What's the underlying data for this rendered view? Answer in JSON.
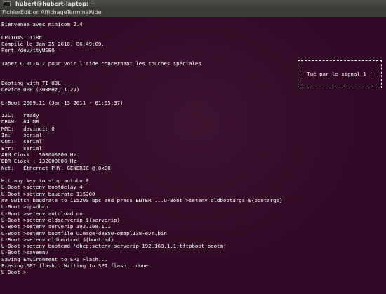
{
  "window": {
    "title": "hubert@hubert-laptop: ~"
  },
  "menu": [
    "Fichier",
    "Édition",
    "Affichage",
    "Terminal",
    "Aide"
  ],
  "terminal": {
    "lines": [
      "Bienvenue avec minicom 2.4",
      "",
      "OPTIONS: I18n",
      "Compilé le Jan 25 2010, 06:49:09.",
      "Port /dev/ttyUSB0",
      "",
      "Tapez CTRL-A Z pour voir l'aide concernant les touches spéciales",
      "",
      "",
      "Booting with TI UBL",
      "Device OPP (300MHz, 1.2V)",
      "",
      "U-Boot 2009.11 (Jan 13 2011 - 01:05:37)",
      "",
      "I2C:   ready",
      "DRAM:  64 MB",
      "MMC:   davinci: 0",
      "In:    serial",
      "Out:   serial",
      "Err:   serial",
      "ARM Clock : 300000000 Hz",
      "DDR Clock : 132000000 Hz",
      "Net:   Ethernet PHY: GENERIC @ 0x00",
      "",
      "Hit any key to stop autobo 0",
      "U-Boot >setenv bootdelay 4",
      "U-Boot >setenv baudrate 115200",
      "## Switch baudrate to 115200 bps and press ENTER ...U-Boot >setenv oldbootargs ${bootargs}",
      "U-Boot >ip=dhcp",
      "U-Boot >setenv autoload no",
      "U-Boot >setenv oldserverip ${serverip}",
      "U-Boot >setenv serverip 192.168.1.1",
      "U-Boot >setenv bootfile uImage-da850-omapl138-evm.bin",
      "U-Boot >setenv oldbootcmd ${bootcmd}",
      "U-Boot >setenv bootcmd 'dhcp;setenv serverip 192.168.1.1;tftpboot;bootm'",
      "U-Boot >saveenv",
      "Saving Environment to SPI Flash...",
      "Erasing SPI flash...Writing to SPI flash...done",
      "U-Boot >"
    ],
    "killed_message": "Tué par le signal 1 !"
  },
  "colors": {
    "terminal_bg": "#300a24",
    "terminal_fg": "#ffffff",
    "titlebar_bg": "#4f4e48",
    "menubar_bg": "#3c3b37"
  }
}
